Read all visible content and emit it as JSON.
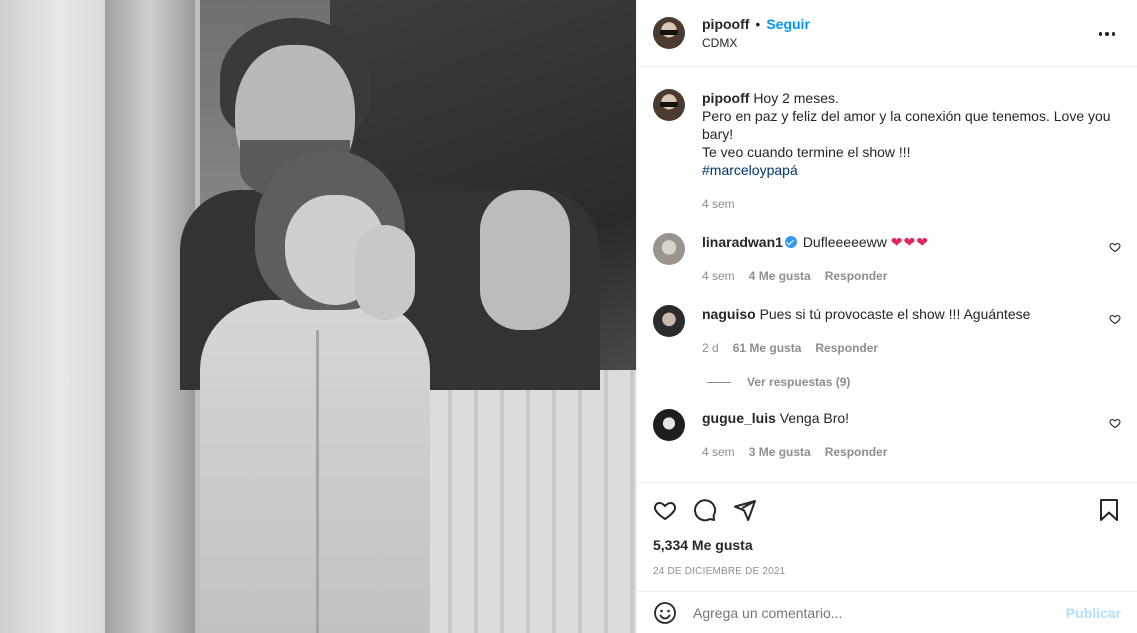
{
  "header": {
    "username": "pipooff",
    "follow_label": "Seguir",
    "location": "CDMX",
    "separator": "•"
  },
  "caption": {
    "username": "pipooff",
    "line1": "Hoy 2 meses.",
    "line2": "Pero en paz y feliz del amor y la conexión que tenemos. Love you bary!",
    "line3": "Te veo cuando termine el show !!!",
    "hashtag": "#marceloypapá",
    "time": "4 sem"
  },
  "comments": [
    {
      "username": "linaradwan1",
      "verified": true,
      "text": "Dufleeeeeww",
      "hearts": "❤❤❤",
      "time": "4 sem",
      "likes": "4 Me gusta",
      "reply": "Responder"
    },
    {
      "username": "naguiso",
      "text": "Pues si tú provocaste el show !!! Aguántese",
      "time": "2 d",
      "likes": "61 Me gusta",
      "reply": "Responder",
      "view_replies": "Ver respuestas (9)"
    },
    {
      "username": "gugue_luis",
      "text": "Venga Bro!",
      "time": "4 sem",
      "likes": "3 Me gusta",
      "reply": "Responder"
    }
  ],
  "stats": {
    "likes": "5,334 Me gusta",
    "date": "24 DE DICIEMBRE DE 2021"
  },
  "add_comment": {
    "placeholder": "Agrega un comentario...",
    "post_label": "Publicar"
  },
  "colors": {
    "accent": "#0095f6",
    "muted": "#8e8e8e",
    "hashtag": "#00376b",
    "post_disabled": "#b2dffc",
    "heart": "#e0245e"
  },
  "icons": [
    "heart-icon",
    "comment-icon",
    "share-icon",
    "bookmark-icon",
    "emoji-icon",
    "more-icon",
    "verified-icon"
  ]
}
